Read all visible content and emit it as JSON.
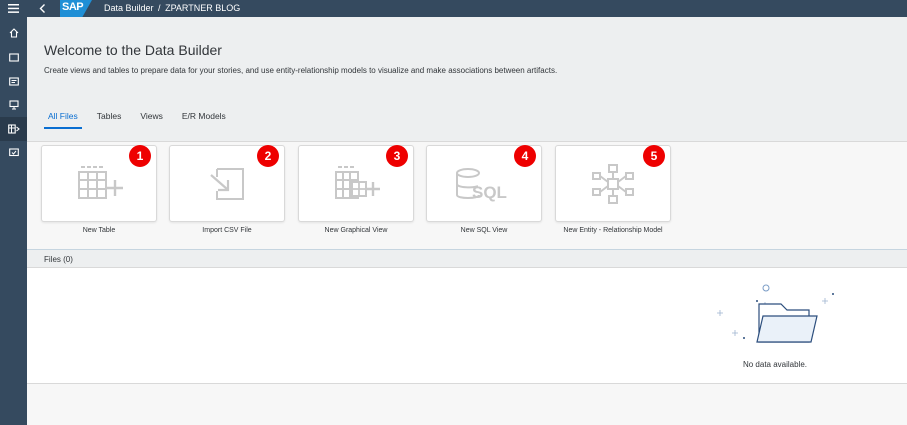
{
  "shell": {
    "logo_text": "SAP",
    "breadcrumb": {
      "parent": "Data Builder",
      "separator": "/",
      "current": "ZPARTNER BLOG"
    },
    "icons": {
      "menu": "hamburger-menu-icon",
      "back": "chevron-left-icon"
    }
  },
  "nav": {
    "items": [
      {
        "icon": "home-icon"
      },
      {
        "icon": "folder-icon"
      },
      {
        "icon": "catalog-icon"
      },
      {
        "icon": "presentation-icon"
      },
      {
        "icon": "data-builder-icon",
        "active": true
      },
      {
        "icon": "monitor-icon"
      }
    ]
  },
  "header": {
    "title": "Welcome to the Data Builder",
    "subtitle": "Create views and tables to prepare data for your stories, and use entity-relationship models to visualize and make associations between artifacts."
  },
  "tabs": [
    {
      "label": "All Files",
      "selected": true
    },
    {
      "label": "Tables"
    },
    {
      "label": "Views"
    },
    {
      "label": "E/R Models"
    }
  ],
  "tiles": [
    {
      "label": "New Table",
      "badge": "1",
      "icon": "new-table-icon"
    },
    {
      "label": "Import CSV File",
      "badge": "2",
      "icon": "import-icon"
    },
    {
      "label": "New Graphical View",
      "badge": "3",
      "icon": "graphical-view-icon"
    },
    {
      "label": "New SQL View",
      "badge": "4",
      "icon": "sql-view-icon"
    },
    {
      "label": "New Entity - Relationship Model",
      "badge": "5",
      "icon": "er-model-icon"
    }
  ],
  "files": {
    "label": "Files (0)",
    "empty_text": "No data available."
  },
  "colors": {
    "shell": "#354a5f",
    "accent": "#0a6ed1",
    "badge": "#ee0000",
    "icon_gray": "#bfbfbf"
  }
}
